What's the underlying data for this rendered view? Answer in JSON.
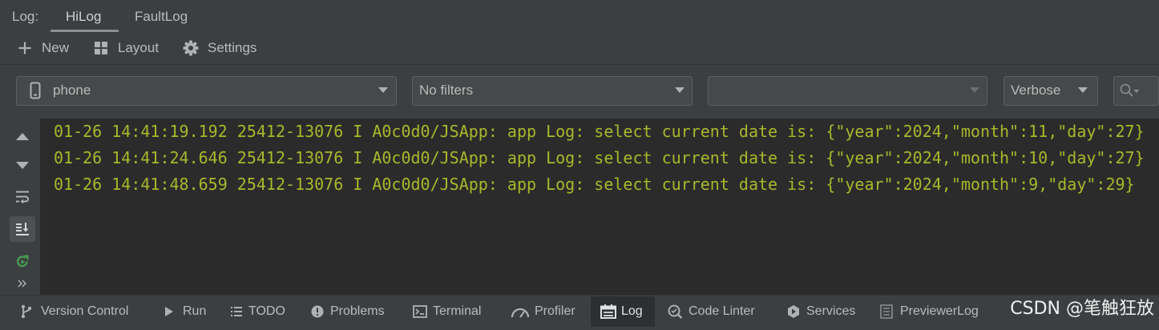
{
  "colors": {
    "panel_bg": "#3c3f41",
    "log_bg": "#2b2b2b",
    "log_text": "#a8b82c",
    "ui_text": "#bbbbbb",
    "field_bg": "#45494a",
    "field_border": "#5e6060",
    "selected_tab_underline": "#8d9093",
    "selected_tool_bg": "#2d2f31",
    "restart_green": "#499c54"
  },
  "log_panel": {
    "title_label": "Log:",
    "tabs": [
      {
        "label": "HiLog",
        "selected": true
      },
      {
        "label": "FaultLog",
        "selected": false
      }
    ]
  },
  "toolbar": {
    "new": {
      "label": "New",
      "icon": "plus-icon"
    },
    "layout": {
      "label": "Layout",
      "icon": "grid-icon"
    },
    "settings": {
      "label": "Settings",
      "icon": "gear-icon"
    }
  },
  "filters": {
    "device": {
      "value": "phone",
      "icon": "phone-icon"
    },
    "log_filter": {
      "value": "No filters"
    },
    "process": {
      "value": ""
    },
    "level": {
      "value": "Verbose"
    },
    "search": {
      "value": "",
      "icon": "search-icon"
    }
  },
  "side_actions": [
    {
      "icon": "up-arrow-icon",
      "active": false
    },
    {
      "icon": "down-arrow-icon",
      "active": false
    },
    {
      "icon": "soft-wrap-icon",
      "active": false
    },
    {
      "icon": "scroll-to-end-icon",
      "active": true
    },
    {
      "icon": "restart-icon",
      "active": false
    },
    {
      "icon": "more-icon",
      "active": false
    }
  ],
  "log_lines": [
    "01-26 14:41:19.192 25412-13076 I A0c0d0/JSApp: app Log: select current date is: {\"year\":2024,\"month\":11,\"day\":27}",
    "01-26 14:41:24.646 25412-13076 I A0c0d0/JSApp: app Log: select current date is: {\"year\":2024,\"month\":10,\"day\":27}",
    "01-26 14:41:48.659 25412-13076 I A0c0d0/JSApp: app Log: select current date is: {\"year\":2024,\"month\":9,\"day\":29}"
  ],
  "tool_windows": [
    {
      "label": "Version Control",
      "icon": "branch-icon",
      "selected": false
    },
    {
      "label": "Run",
      "icon": "play-icon",
      "selected": false
    },
    {
      "label": "TODO",
      "icon": "list-icon",
      "selected": false
    },
    {
      "label": "Problems",
      "icon": "problems-icon",
      "selected": false
    },
    {
      "label": "Terminal",
      "icon": "terminal-icon",
      "selected": false
    },
    {
      "label": "Profiler",
      "icon": "gauge-icon",
      "selected": false
    },
    {
      "label": "Log",
      "icon": "log-icon",
      "selected": true
    },
    {
      "label": "Code Linter",
      "icon": "code-linter-icon",
      "selected": false
    },
    {
      "label": "Services",
      "icon": "services-icon",
      "selected": false
    },
    {
      "label": "PreviewerLog",
      "icon": "previewer-log-icon",
      "selected": false
    }
  ],
  "watermark": "CSDN @笔触狂放"
}
